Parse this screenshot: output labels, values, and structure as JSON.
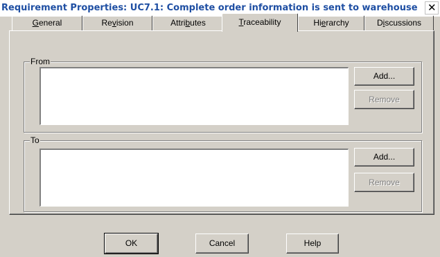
{
  "window": {
    "title": "Requirement Properties: UC7.1: Complete order information is sent to warehouse",
    "close_glyph": "✕"
  },
  "tabs": [
    {
      "pre": "",
      "key": "G",
      "post": "eneral",
      "selected": false
    },
    {
      "pre": "Re",
      "key": "v",
      "post": "ision",
      "selected": false
    },
    {
      "pre": "Attri",
      "key": "b",
      "post": "utes",
      "selected": false
    },
    {
      "pre": "",
      "key": "T",
      "post": "raceability",
      "selected": true
    },
    {
      "pre": "Hi",
      "key": "e",
      "post": "rarchy",
      "selected": false
    },
    {
      "pre": "D",
      "key": "i",
      "post": "scussions",
      "selected": false
    }
  ],
  "from_group": {
    "label": "From",
    "add_label": "Add...",
    "remove_label": "Remove"
  },
  "to_group": {
    "label": "To",
    "add_label": "Add...",
    "remove_label": "Remove"
  },
  "dialog_buttons": {
    "ok": "OK",
    "cancel": "Cancel",
    "help": "Help"
  }
}
